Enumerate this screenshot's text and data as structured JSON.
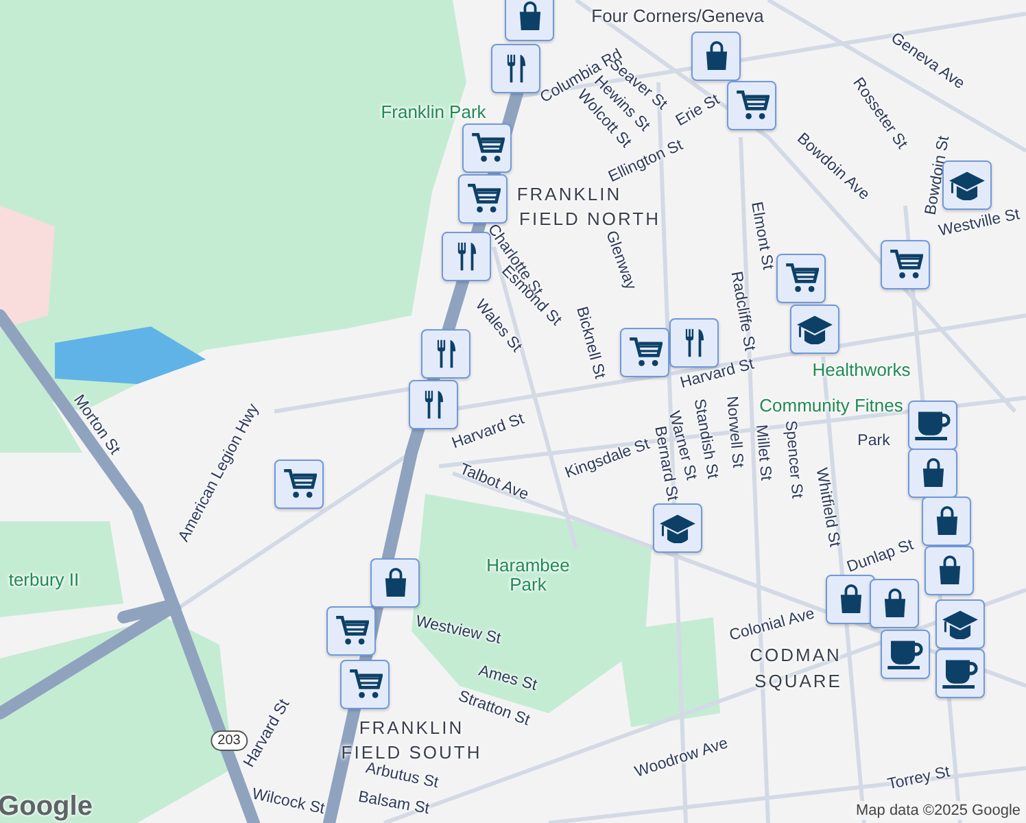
{
  "map": {
    "labels": [
      {
        "text": "Four Corners/Geneva",
        "kind": "station"
      },
      {
        "text": "Geneva Ave",
        "kind": "street"
      },
      {
        "text": "Columbia Rd",
        "kind": "street"
      },
      {
        "text": "Seaver St",
        "kind": "street"
      },
      {
        "text": "Hewins St",
        "kind": "street"
      },
      {
        "text": "Wolcott St",
        "kind": "street"
      },
      {
        "text": "Erie St",
        "kind": "street"
      },
      {
        "text": "Rosseter St",
        "kind": "street"
      },
      {
        "text": "Ellington St",
        "kind": "street"
      },
      {
        "text": "Bowdoin Ave",
        "kind": "street"
      },
      {
        "text": "Bowdoin St",
        "kind": "street"
      },
      {
        "text": "Westville St",
        "kind": "street"
      },
      {
        "text": "FRANKLIN",
        "kind": "area"
      },
      {
        "text": "FIELD NORTH",
        "kind": "area"
      },
      {
        "text": "Franklin Park",
        "kind": "park"
      },
      {
        "text": "Charlotte St",
        "kind": "street"
      },
      {
        "text": "Esmond St",
        "kind": "street"
      },
      {
        "text": "Wales St",
        "kind": "street"
      },
      {
        "text": "Bicknell St",
        "kind": "street"
      },
      {
        "text": "Glenway",
        "kind": "street"
      },
      {
        "text": "Radcliffe St",
        "kind": "street"
      },
      {
        "text": "Elmont St",
        "kind": "street"
      },
      {
        "text": "Harvard St",
        "kind": "street"
      },
      {
        "text": "Harvard St",
        "kind": "street"
      },
      {
        "text": "Healthworks",
        "kind": "poi"
      },
      {
        "text": "Community Fitnes",
        "kind": "poi"
      },
      {
        "text": "Kingsdale St",
        "kind": "street"
      },
      {
        "text": "Bernard St",
        "kind": "street"
      },
      {
        "text": "Warner St",
        "kind": "street"
      },
      {
        "text": "Standish St",
        "kind": "street"
      },
      {
        "text": "Norwell St",
        "kind": "street"
      },
      {
        "text": "Millet St",
        "kind": "street"
      },
      {
        "text": "Spencer St",
        "kind": "street"
      },
      {
        "text": "Talbot Ave",
        "kind": "street"
      },
      {
        "text": "Park",
        "kind": "street"
      },
      {
        "text": "Dunlap St",
        "kind": "street"
      },
      {
        "text": "Whitfield St",
        "kind": "street"
      },
      {
        "text": "Harambee Park",
        "kind": "park"
      },
      {
        "text": "Westview St",
        "kind": "street"
      },
      {
        "text": "Ames St",
        "kind": "street"
      },
      {
        "text": "Stratton St",
        "kind": "street"
      },
      {
        "text": "Colonial Ave",
        "kind": "street"
      },
      {
        "text": "CODMAN",
        "kind": "area"
      },
      {
        "text": "SQUARE",
        "kind": "area"
      },
      {
        "text": "FRANKLIN",
        "kind": "area"
      },
      {
        "text": "FIELD SOUTH",
        "kind": "area"
      },
      {
        "text": "Arbutus St",
        "kind": "street"
      },
      {
        "text": "Balsam St",
        "kind": "street"
      },
      {
        "text": "Wilcock St",
        "kind": "street"
      },
      {
        "text": "Harvard St",
        "kind": "street"
      },
      {
        "text": "Woodrow Ave",
        "kind": "street"
      },
      {
        "text": "Torrey St",
        "kind": "street"
      },
      {
        "text": "Morton St",
        "kind": "street"
      },
      {
        "text": "American Legion Hwy",
        "kind": "street"
      },
      {
        "text": "terbury II",
        "kind": "park"
      },
      {
        "text": "203",
        "kind": "shield"
      },
      {
        "text": "Google",
        "kind": "logo"
      },
      {
        "text": "Map data ©2025 Google",
        "kind": "attribution"
      }
    ],
    "pins": [
      {
        "kind": "bag"
      },
      {
        "kind": "fork"
      },
      {
        "kind": "bag"
      },
      {
        "kind": "cart"
      },
      {
        "kind": "cart"
      },
      {
        "kind": "cart"
      },
      {
        "kind": "fork"
      },
      {
        "kind": "cart"
      },
      {
        "kind": "cart"
      },
      {
        "kind": "cap"
      },
      {
        "kind": "cap"
      },
      {
        "kind": "fork"
      },
      {
        "kind": "cart"
      },
      {
        "kind": "fork"
      },
      {
        "kind": "fork"
      },
      {
        "kind": "cart"
      },
      {
        "kind": "cup"
      },
      {
        "kind": "bag"
      },
      {
        "kind": "bag"
      },
      {
        "kind": "cap"
      },
      {
        "kind": "bag"
      },
      {
        "kind": "bag"
      },
      {
        "kind": "bag"
      },
      {
        "kind": "cup"
      },
      {
        "kind": "cap"
      },
      {
        "kind": "cup"
      },
      {
        "kind": "bag"
      },
      {
        "kind": "cart"
      },
      {
        "kind": "cart"
      }
    ]
  }
}
